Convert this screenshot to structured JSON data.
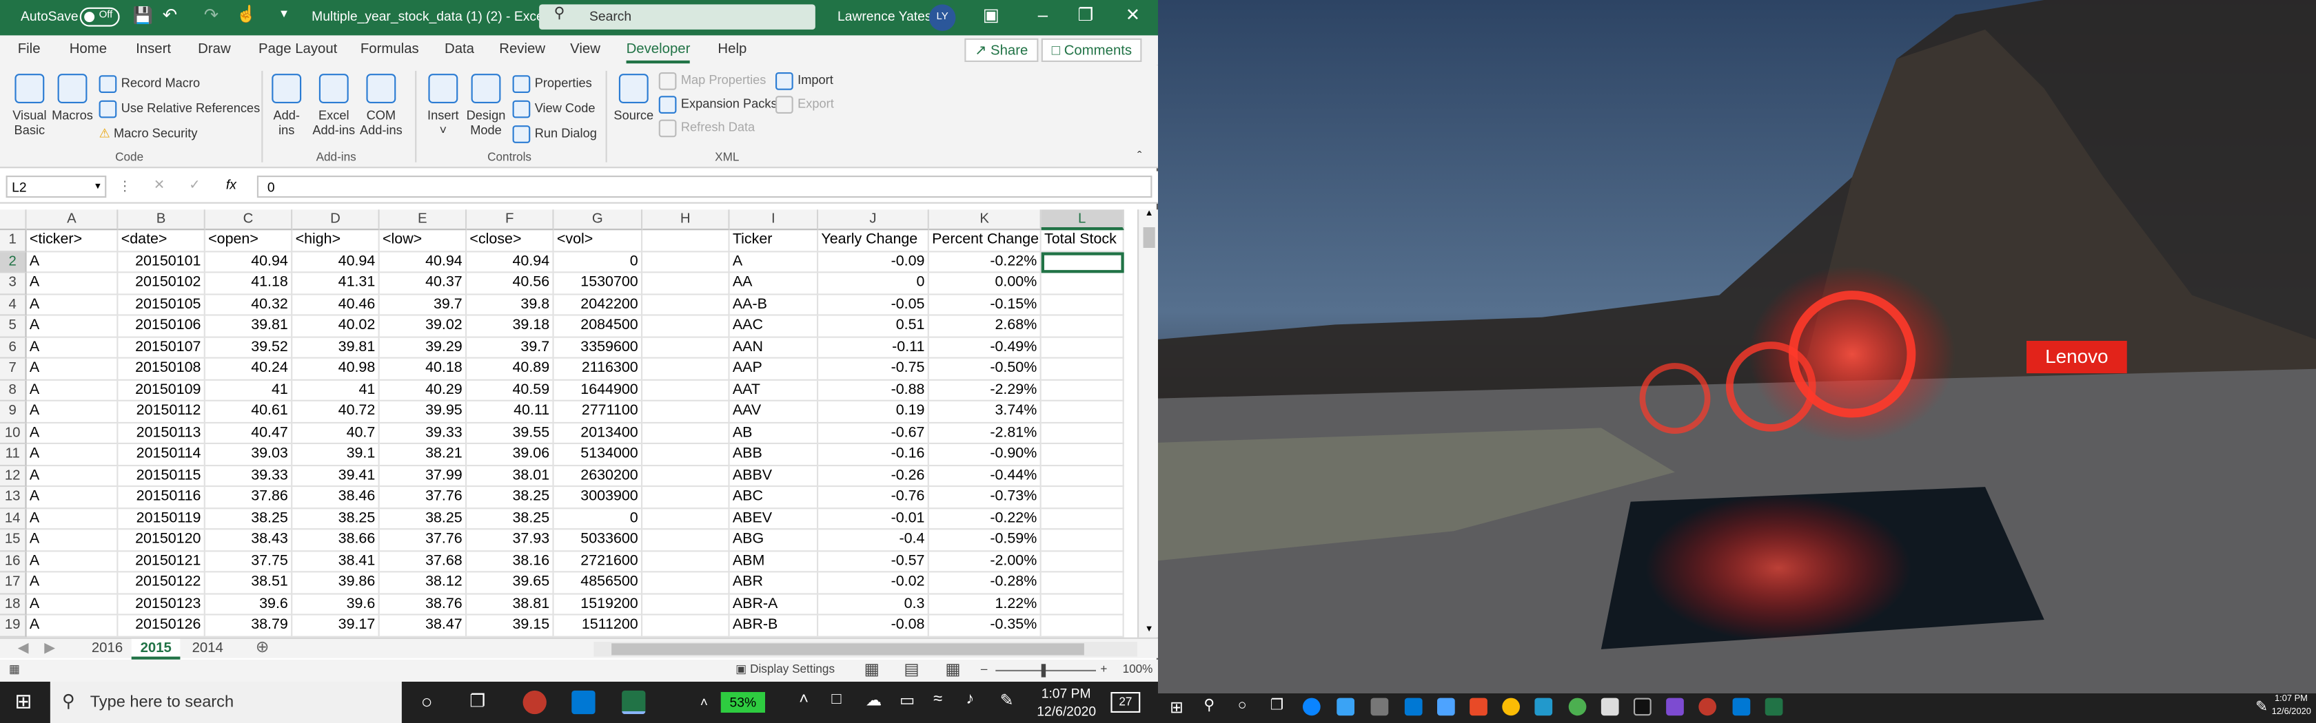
{
  "titlebar": {
    "autosave_label": "AutoSave",
    "autosave_state": "Off",
    "doc_title": "Multiple_year_stock_data (1) (2) - Excel",
    "search_placeholder": "Search",
    "user_name": "Lawrence Yates",
    "user_initials": "LY"
  },
  "menu": {
    "tabs": [
      "File",
      "Home",
      "Insert",
      "Draw",
      "Page Layout",
      "Formulas",
      "Data",
      "Review",
      "View",
      "Developer",
      "Help"
    ],
    "active": "Developer",
    "share": "Share",
    "comments": "Comments"
  },
  "ribbon": {
    "visual_basic": "Visual Basic",
    "macros": "Macros",
    "record_macro": "Record Macro",
    "use_relative": "Use Relative References",
    "macro_security": "Macro Security",
    "group_code": "Code",
    "add_ins": "Add-ins",
    "excel_add_ins": "Excel Add-ins",
    "com_add_ins": "COM Add-ins",
    "group_addins": "Add-ins",
    "insert": "Insert",
    "design_mode": "Design Mode",
    "properties": "Properties",
    "view_code": "View Code",
    "run_dialog": "Run Dialog",
    "group_controls": "Controls",
    "source": "Source",
    "map_properties": "Map Properties",
    "expansion_packs": "Expansion Packs",
    "refresh_data": "Refresh Data",
    "import": "Import",
    "export": "Export",
    "group_xml": "XML"
  },
  "formula_bar": {
    "name_box": "L2",
    "fx": "fx",
    "value": "0"
  },
  "grid": {
    "columns": [
      "A",
      "B",
      "C",
      "D",
      "E",
      "F",
      "G",
      "H",
      "I",
      "J",
      "K",
      "L"
    ],
    "row_numbers": [
      "1",
      "2",
      "3",
      "4",
      "5",
      "6",
      "7",
      "8",
      "9",
      "10",
      "11",
      "12",
      "13",
      "14",
      "15",
      "16",
      "17",
      "18",
      "19"
    ],
    "header_row": [
      "<ticker>",
      "<date>",
      "<open>",
      "<high>",
      "<low>",
      "<close>",
      "<vol>",
      "",
      "Ticker",
      "Yearly Change",
      "Percent Change",
      "Total Stock"
    ],
    "rows": [
      [
        "A",
        "20150101",
        "40.94",
        "40.94",
        "40.94",
        "40.94",
        "0",
        "",
        "A",
        "-0.09",
        "-0.22%",
        ""
      ],
      [
        "A",
        "20150102",
        "41.18",
        "41.31",
        "40.37",
        "40.56",
        "1530700",
        "",
        "AA",
        "0",
        "0.00%",
        ""
      ],
      [
        "A",
        "20150105",
        "40.32",
        "40.46",
        "39.7",
        "39.8",
        "2042200",
        "",
        "AA-B",
        "-0.05",
        "-0.15%",
        ""
      ],
      [
        "A",
        "20150106",
        "39.81",
        "40.02",
        "39.02",
        "39.18",
        "2084500",
        "",
        "AAC",
        "0.51",
        "2.68%",
        ""
      ],
      [
        "A",
        "20150107",
        "39.52",
        "39.81",
        "39.29",
        "39.7",
        "3359600",
        "",
        "AAN",
        "-0.11",
        "-0.49%",
        ""
      ],
      [
        "A",
        "20150108",
        "40.24",
        "40.98",
        "40.18",
        "40.89",
        "2116300",
        "",
        "AAP",
        "-0.75",
        "-0.50%",
        ""
      ],
      [
        "A",
        "20150109",
        "41",
        "41",
        "40.29",
        "40.59",
        "1644900",
        "",
        "AAT",
        "-0.88",
        "-2.29%",
        ""
      ],
      [
        "A",
        "20150112",
        "40.61",
        "40.72",
        "39.95",
        "40.11",
        "2771100",
        "",
        "AAV",
        "0.19",
        "3.74%",
        ""
      ],
      [
        "A",
        "20150113",
        "40.47",
        "40.7",
        "39.33",
        "39.55",
        "2013400",
        "",
        "AB",
        "-0.67",
        "-2.81%",
        ""
      ],
      [
        "A",
        "20150114",
        "39.03",
        "39.1",
        "38.21",
        "39.06",
        "5134000",
        "",
        "ABB",
        "-0.16",
        "-0.90%",
        ""
      ],
      [
        "A",
        "20150115",
        "39.33",
        "39.41",
        "37.99",
        "38.01",
        "2630200",
        "",
        "ABBV",
        "-0.26",
        "-0.44%",
        ""
      ],
      [
        "A",
        "20150116",
        "37.86",
        "38.46",
        "37.76",
        "38.25",
        "3003900",
        "",
        "ABC",
        "-0.76",
        "-0.73%",
        ""
      ],
      [
        "A",
        "20150119",
        "38.25",
        "38.25",
        "38.25",
        "38.25",
        "0",
        "",
        "ABEV",
        "-0.01",
        "-0.22%",
        ""
      ],
      [
        "A",
        "20150120",
        "38.43",
        "38.66",
        "37.76",
        "37.93",
        "5033600",
        "",
        "ABG",
        "-0.4",
        "-0.59%",
        ""
      ],
      [
        "A",
        "20150121",
        "37.75",
        "38.41",
        "37.68",
        "38.16",
        "2721600",
        "",
        "ABM",
        "-0.57",
        "-2.00%",
        ""
      ],
      [
        "A",
        "20150122",
        "38.51",
        "39.86",
        "38.12",
        "39.65",
        "4856500",
        "",
        "ABR",
        "-0.02",
        "-0.28%",
        ""
      ],
      [
        "A",
        "20150123",
        "39.6",
        "39.6",
        "38.76",
        "38.81",
        "1519200",
        "",
        "ABR-A",
        "0.3",
        "1.22%",
        ""
      ],
      [
        "A",
        "20150126",
        "38.79",
        "39.17",
        "38.47",
        "39.15",
        "1511200",
        "",
        "ABR-B",
        "-0.08",
        "-0.35%",
        ""
      ]
    ]
  },
  "sheets": {
    "tabs": [
      "2016",
      "2015",
      "2014"
    ],
    "active": "2015"
  },
  "status": {
    "display_settings": "Display Settings",
    "zoom": "100%"
  },
  "desktop": {
    "brand": "Lenovo"
  },
  "taskbar": {
    "search_placeholder": "Type here to search",
    "battery": "53%",
    "time": "1:07 PM",
    "date": "12/6/2020",
    "notifications": "27",
    "time2": "1:07 PM",
    "date2": "12/6/2020"
  }
}
